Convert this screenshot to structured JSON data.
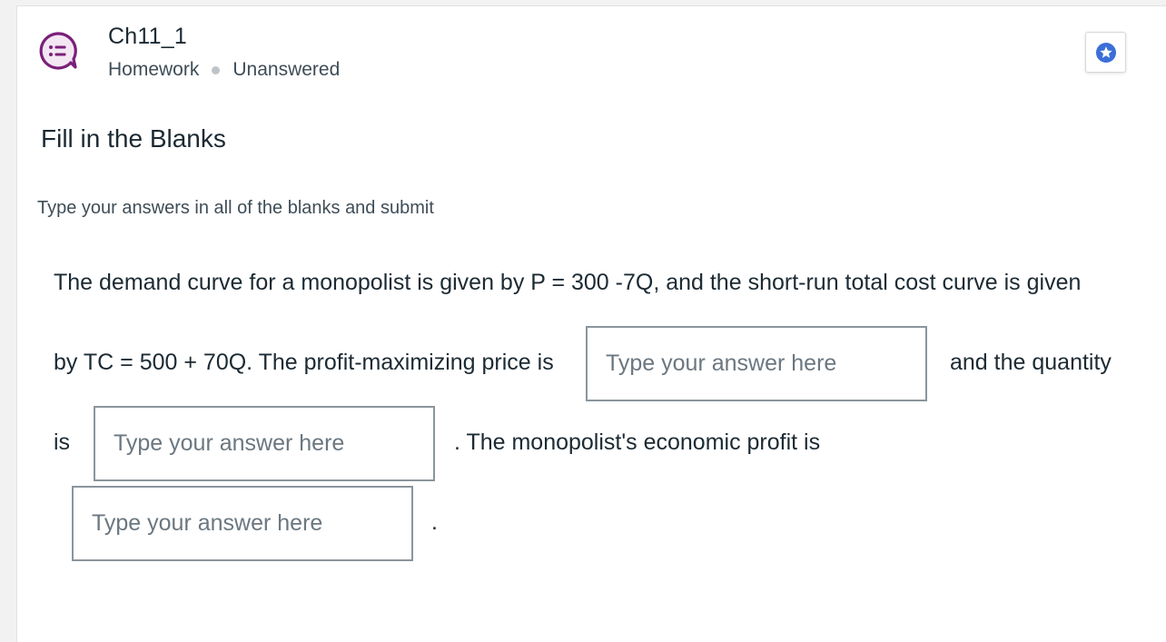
{
  "header": {
    "title": "Ch11_1",
    "type": "Homework",
    "status": "Unanswered"
  },
  "section_title": "Fill in the Blanks",
  "instructions": "Type your answers in all of the blanks and submit",
  "question": {
    "line1": "The demand curve for a monopolist is given by P = 300  -7Q, and the short-run total cost curve is given",
    "line2_prefix": "by TC = 500 + 70Q. The profit-maximizing price is",
    "line2_suffix": "and the quantity",
    "line3_prefix": "is",
    "line3_suffix": ". The monopolist's economic profit is",
    "line4_suffix": "."
  },
  "blanks": {
    "price": {
      "value": "",
      "placeholder": "Type your answer here"
    },
    "quantity": {
      "value": "",
      "placeholder": "Type your answer here"
    },
    "profit": {
      "value": "",
      "placeholder": "Type your answer here"
    }
  },
  "icons": {
    "question": "question-bubble-icon",
    "bookmark": "star-icon"
  },
  "colors": {
    "icon_purple": "#7a1f7a",
    "star_blue": "#3b6fd8",
    "border_gray": "#8b959c"
  }
}
